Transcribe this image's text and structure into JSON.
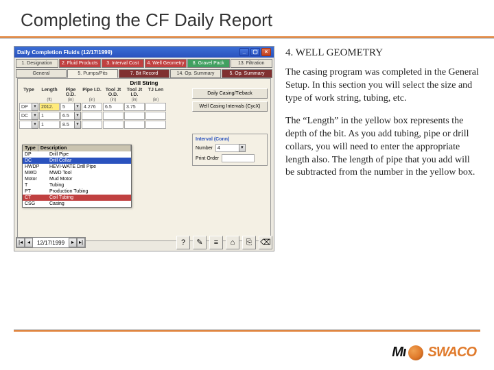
{
  "slide": {
    "title": "Completing the CF Daily Report"
  },
  "window": {
    "title": "Daily Completion Fluids (12/17/1999)",
    "min": "_",
    "max": "▢",
    "close": "×"
  },
  "tabs_row1": [
    {
      "label": "1. Designation",
      "cls": ""
    },
    {
      "label": "2. Fluid Products",
      "cls": "red"
    },
    {
      "label": "3. Interval Cost",
      "cls": "red"
    },
    {
      "label": "4. Well Geometry",
      "cls": "red"
    },
    {
      "label": "8. Gravel Pack",
      "cls": "green"
    },
    {
      "label": "13. Filtration",
      "cls": ""
    }
  ],
  "tabs_row2": [
    {
      "label": "General",
      "cls": ""
    },
    {
      "label": "5. Pumps/Pits",
      "cls": "active"
    },
    {
      "label": "7. Bit Record",
      "cls": "maroon"
    },
    {
      "label": "14. Op. Summary",
      "cls": ""
    },
    {
      "label": "5. Op. Summary",
      "cls": "maroon"
    }
  ],
  "drillstring": {
    "heading": "Drill String",
    "cols": [
      "Type",
      "Length",
      "Pipe O.D.",
      "Pipe I.D.",
      "Tool Jt O.D.",
      "Tool Jt I.D.",
      "TJ Len"
    ],
    "units": [
      "(ft)",
      "(in)",
      "(in)",
      "(in)",
      "(in)",
      "(in)"
    ],
    "rows": [
      {
        "type": "DP",
        "length": "2012.",
        "pod": "5",
        "pid": "4.276",
        "tjod": "6.5",
        "tjid": "3.75",
        "tjlen": ""
      },
      {
        "type": "DC",
        "length": " 1",
        "pod": "6.5",
        "pid": "",
        "tjod": "",
        "tjid": "",
        "tjlen": ""
      },
      {
        "type": "",
        "length": " 1",
        "pod": "8.5",
        "pid": "",
        "tjod": "",
        "tjid": "",
        "tjlen": ""
      }
    ]
  },
  "dropdown": {
    "h1": "Type",
    "h2": "Description",
    "rows": [
      {
        "t": "DP",
        "d": "Drill Pipe"
      },
      {
        "t": "DC",
        "d": "Drill Collar",
        "sel": true
      },
      {
        "t": "HWDP",
        "d": "HEVI-WATE Drill Pipe"
      },
      {
        "t": "MWD",
        "d": "MWD Tool"
      },
      {
        "t": "Motor",
        "d": "Mud Motor"
      },
      {
        "t": "T",
        "d": "Tubing"
      },
      {
        "t": "PT",
        "d": "Production Tubing"
      },
      {
        "t": "CT",
        "d": "Coil Tubing"
      },
      {
        "t": "CSG",
        "d": "Casing"
      }
    ]
  },
  "side_buttons": {
    "b1": "Daily Casing/Tieback",
    "b2": "Well Casing Intervals (CycX)"
  },
  "conn": {
    "title": "Interval (Conn)",
    "num_lbl": "Number",
    "num_val": "4",
    "order_lbl": "Print Order",
    "order_val": ""
  },
  "bottom": {
    "date": "12/17/1999",
    "nav_first": "|◂",
    "nav_prev": "◂",
    "nav_next": "▸",
    "nav_last": "▸|",
    "icons": [
      "?",
      "✎",
      "≡",
      "⌂",
      "⎘",
      "⌫"
    ]
  },
  "explain": {
    "heading": "4. WELL GEOMETRY",
    "p1": "The casing program was completed in the General Setup. In this section you will select the size and type of work string, tubing, etc.",
    "p2": "The “Length” in the yellow box represents the depth of the bit. As you add tubing, pipe or drill collars, you will need to enter the appropriate length also. The length of pipe that you add will be subtracted from the number in the yellow box."
  },
  "logo": {
    "mi": "Mı",
    "swaco": "SWACO"
  }
}
